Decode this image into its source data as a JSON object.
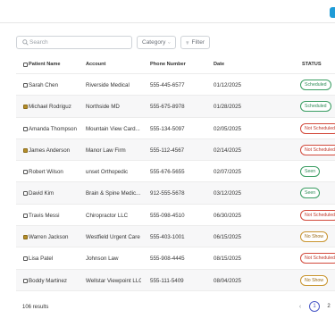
{
  "toolbar": {
    "search_placeholder": "Search",
    "category_label": "Category",
    "filter_label": "Filter"
  },
  "table": {
    "headers": [
      "Patient Name",
      "Account",
      "Phone Number",
      "Date",
      "STATUS"
    ],
    "rows": [
      {
        "name": "Sarah Chen",
        "account": "Riverside Medical",
        "phone": "555-445-6577",
        "date": "01/12/2025",
        "status": "Scheduled",
        "status_type": "ok",
        "checkbox": "empty"
      },
      {
        "name": "Michael Rodriguz",
        "account": "Northside MD",
        "phone": "555-675-8978",
        "date": "01/28/2025",
        "status": "Scheduled",
        "status_type": "ok",
        "checkbox": "filled"
      },
      {
        "name": "Amanda Thompson",
        "account": "Mountain View Card...",
        "phone": "555-134-5097",
        "date": "02/05/2025",
        "status": "Not Scheduled",
        "status_type": "bad",
        "checkbox": "empty"
      },
      {
        "name": "James Anderson",
        "account": "Manor Law Firm",
        "phone": "555-112-4567",
        "date": "02/14/2025",
        "status": "Not Scheduled",
        "status_type": "bad",
        "checkbox": "filled"
      },
      {
        "name": "Robert Wilson",
        "account": "unset Orthopedic",
        "phone": "555-676-5655",
        "date": "02/07/2025",
        "status": "Seen",
        "status_type": "ok",
        "checkbox": "empty"
      },
      {
        "name": "David Kim",
        "account": "Brain & Spine Medic...",
        "phone": "912-555-5678",
        "date": "03/12/2025",
        "status": "Seen",
        "status_type": "ok",
        "checkbox": "empty"
      },
      {
        "name": "Travis Messi",
        "account": "Chiropractor LLC",
        "phone": "555-098-4510",
        "date": "06/30/2025",
        "status": "Not Scheduled",
        "status_type": "bad",
        "checkbox": "empty"
      },
      {
        "name": "Warren Jackson",
        "account": "Westfield Urgent Care",
        "phone": "555-403-1001",
        "date": "06/15/2025",
        "status": "No Show",
        "status_type": "warn",
        "checkbox": "filled"
      },
      {
        "name": "Lisa Patel",
        "account": "Johnson Law",
        "phone": "555-908-4445",
        "date": "08/15/2025",
        "status": "Not Scheduled",
        "status_type": "bad",
        "checkbox": "empty"
      },
      {
        "name": "Boddy Martinez",
        "account": "Wellstar Viewpoint LLC",
        "phone": "555-111-5409",
        "date": "08/04/2025",
        "status": "No Show",
        "status_type": "warn",
        "checkbox": "empty"
      }
    ]
  },
  "footer": {
    "results_text": "106 results",
    "pages": [
      "1",
      "2"
    ],
    "active_page": "1",
    "prev_icon": "chevron-left-icon"
  },
  "colors": {
    "accent": "#1e9bd7",
    "scheduled": "#2e8b57",
    "not_scheduled": "#c0392b",
    "no_show": "#9a6a14",
    "pager_active": "#4a59c7"
  }
}
